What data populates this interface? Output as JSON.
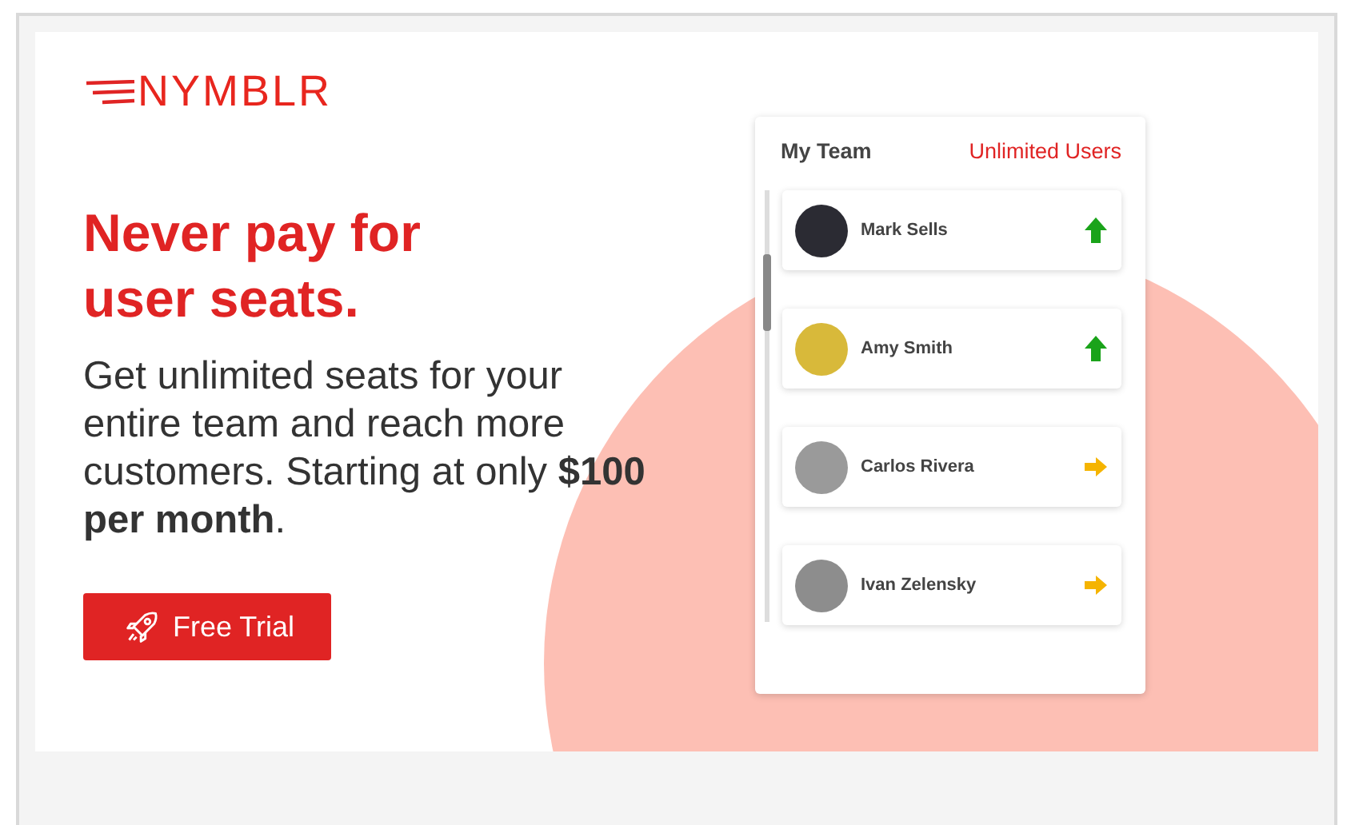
{
  "logo": {
    "text": "NYMBLR"
  },
  "headline": "Never pay for user seats.",
  "description": "Get unlimited seats for your entire team and reach more customers. Starting at only **$100 per month**.",
  "cta_button": {
    "label": "Free Trial"
  },
  "team_card": {
    "title": "My Team",
    "badge": "Unlimited Users",
    "members": [
      {
        "name": "Mark Sells",
        "kind": "up",
        "color": "#1aa31a"
      },
      {
        "name": "Amy Smith",
        "kind": "up",
        "color": "#1aa31a"
      },
      {
        "name": "Carlos Rivera",
        "kind": "right",
        "color": "#f5b400"
      },
      {
        "name": "Ivan Zelensky",
        "kind": "right",
        "color": "#f5b400"
      }
    ]
  }
}
